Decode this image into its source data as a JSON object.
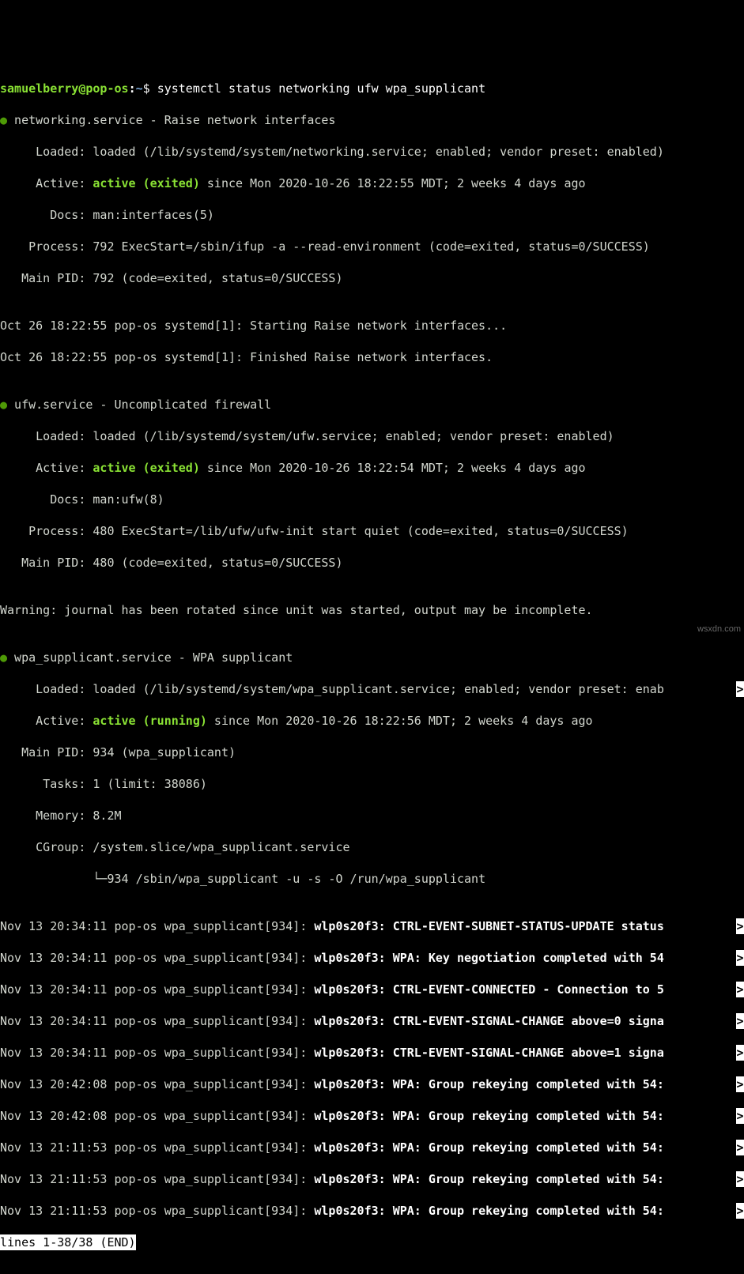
{
  "prompt": {
    "user": "samuelberry@pop-os",
    "colon": ":",
    "path": "~",
    "dollar": "$ ",
    "command": "systemctl status networking ufw wpa_supplicant"
  },
  "svc1": {
    "bullet": "●",
    "title": " networking.service - Raise network interfaces",
    "loaded": "     Loaded: loaded (/lib/systemd/system/networking.service; enabled; vendor preset: enabled)",
    "active_label": "     Active: ",
    "active_status": "active (exited)",
    "active_rest": " since Mon 2020-10-26 18:22:55 MDT; 2 weeks 4 days ago",
    "docs": "       Docs: man:interfaces(5)",
    "process": "    Process: 792 ExecStart=/sbin/ifup -a --read-environment (code=exited, status=0/SUCCESS)",
    "mainpid": "   Main PID: 792 (code=exited, status=0/SUCCESS)",
    "blank": "",
    "log1": "Oct 26 18:22:55 pop-os systemd[1]: Starting Raise network interfaces...",
    "log2": "Oct 26 18:22:55 pop-os systemd[1]: Finished Raise network interfaces.",
    "blank2": ""
  },
  "svc2": {
    "bullet": "●",
    "title": " ufw.service - Uncomplicated firewall",
    "loaded": "     Loaded: loaded (/lib/systemd/system/ufw.service; enabled; vendor preset: enabled)",
    "active_label": "     Active: ",
    "active_status": "active (exited)",
    "active_rest": " since Mon 2020-10-26 18:22:54 MDT; 2 weeks 4 days ago",
    "docs": "       Docs: man:ufw(8)",
    "process": "    Process: 480 ExecStart=/lib/ufw/ufw-init start quiet (code=exited, status=0/SUCCESS)",
    "mainpid": "   Main PID: 480 (code=exited, status=0/SUCCESS)",
    "blank": "",
    "warn": "Warning: journal has been rotated since unit was started, output may be incomplete.",
    "blank2": ""
  },
  "svc3": {
    "bullet": "●",
    "title": " wpa_supplicant.service - WPA supplicant",
    "loaded": "     Loaded: loaded (/lib/systemd/system/wpa_supplicant.service; enabled; vendor preset: enab",
    "active_label": "     Active: ",
    "active_status": "active (running)",
    "active_rest": " since Mon 2020-10-26 18:22:56 MDT; 2 weeks 4 days ago",
    "mainpid": "   Main PID: 934 (wpa_supplicant)",
    "tasks": "      Tasks: 1 (limit: 38086)",
    "memory": "     Memory: 8.2M",
    "cgroup": "     CGroup: /system.slice/wpa_supplicant.service",
    "tree": "             └─",
    "treeline": "934 /sbin/wpa_supplicant -u -s -O /run/wpa_supplicant",
    "blank": "",
    "logprefix1": "Nov 13 20:34:11 pop-os wpa_supplicant[934]: ",
    "logprefix2": "Nov 13 20:42:08 pop-os wpa_supplicant[934]: ",
    "logprefix3": "Nov 13 21:11:53 pop-os wpa_supplicant[934]: ",
    "l1": "wlp0s20f3: CTRL-EVENT-SUBNET-STATUS-UPDATE status",
    "l2": "wlp0s20f3: WPA: Key negotiation completed with 54",
    "l3": "wlp0s20f3: CTRL-EVENT-CONNECTED - Connection to 5",
    "l4": "wlp0s20f3: CTRL-EVENT-SIGNAL-CHANGE above=0 signa",
    "l5": "wlp0s20f3: CTRL-EVENT-SIGNAL-CHANGE above=1 signa",
    "l6": "wlp0s20f3: WPA: Group rekeying completed with 54:",
    "l7": "wlp0s20f3: WPA: Group rekeying completed with 54:",
    "l8": "wlp0s20f3: WPA: Group rekeying completed with 54:",
    "l9": "wlp0s20f3: WPA: Group rekeying completed with 54:",
    "l10": "wlp0s20f3: WPA: Group rekeying completed with 54:"
  },
  "trunc": ">",
  "pager": "lines 1-38/38 (END)",
  "watermark": "wsxdn.com"
}
